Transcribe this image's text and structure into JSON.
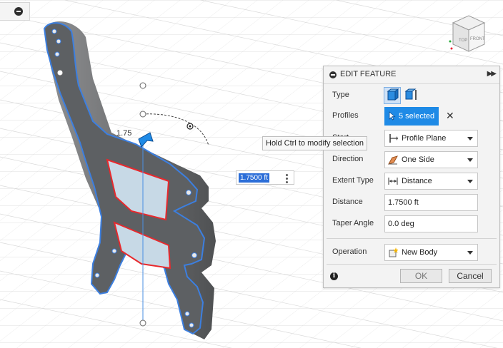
{
  "panel": {
    "collapse_label": ""
  },
  "tooltip": {
    "text": "Hold Ctrl to modify selection"
  },
  "manipulator": {
    "distance_input": "1.7500 ft",
    "dimension_label": "1.75"
  },
  "viewcube": {
    "top_label": "TOP",
    "front_label": "FRONT"
  },
  "dialog": {
    "title": "EDIT FEATURE",
    "rows": {
      "type": {
        "label": "Type"
      },
      "profiles": {
        "label": "Profiles",
        "value": "5 selected"
      },
      "start": {
        "label": "Start",
        "value": "Profile Plane"
      },
      "direction": {
        "label": "Direction",
        "value": "One Side"
      },
      "extent_type": {
        "label": "Extent Type",
        "value": "Distance"
      },
      "distance": {
        "label": "Distance",
        "value": "1.7500 ft"
      },
      "taper_angle": {
        "label": "Taper Angle",
        "value": "0.0 deg"
      },
      "operation": {
        "label": "Operation",
        "value": "New Body"
      }
    },
    "ok_label": "OK",
    "cancel_label": "Cancel"
  },
  "colors": {
    "accent": "#1e8ae6",
    "profile_highlight": "#e8292d",
    "edge_highlight": "#3c7fe0",
    "body": "#5f6163"
  }
}
